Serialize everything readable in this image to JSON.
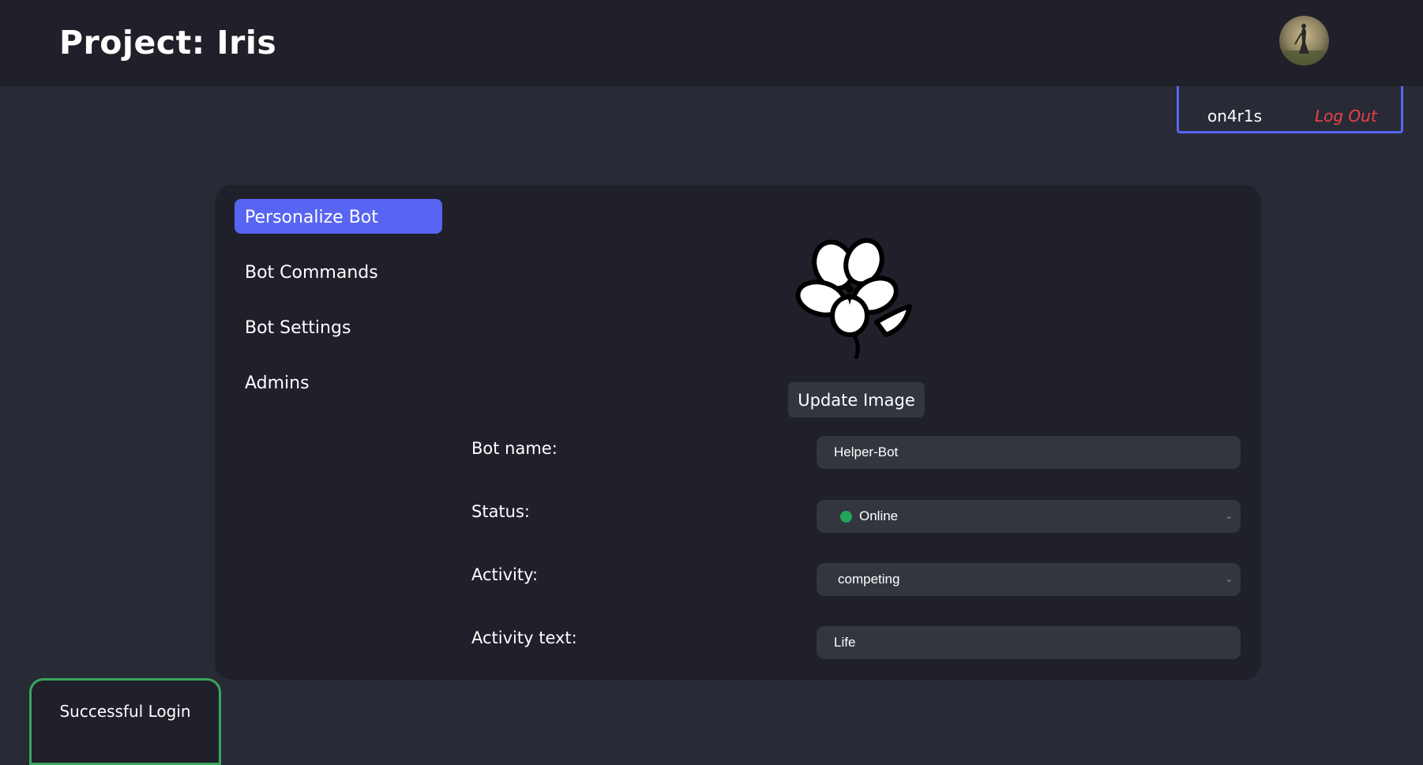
{
  "header": {
    "title": "Project: Iris",
    "avatar_icon": "user-avatar"
  },
  "user": {
    "username": "on4r1s",
    "logout_label": "Log Out"
  },
  "sidebar": {
    "items": [
      {
        "label": "Personalize Bot",
        "active": true
      },
      {
        "label": "Bot Commands",
        "active": false
      },
      {
        "label": "Bot Settings",
        "active": false
      },
      {
        "label": "Admins",
        "active": false
      }
    ]
  },
  "bot": {
    "image_icon": "flower-icon",
    "update_image_label": "Update Image",
    "fields": {
      "name": {
        "label": "Bot name:",
        "value": "Helper-Bot"
      },
      "status": {
        "label": "Status:",
        "value": "Online",
        "status_color": "#23a55a"
      },
      "activity": {
        "label": "Activity:",
        "value": "competing"
      },
      "activity_text": {
        "label": "Activity text:",
        "value": "Life"
      }
    }
  },
  "toast": {
    "message": "Successful Login",
    "color": "#3ba55d"
  },
  "colors": {
    "accent": "#5865f2",
    "danger": "#ed4245",
    "background": "#282a36",
    "panel": "#1f2029"
  }
}
